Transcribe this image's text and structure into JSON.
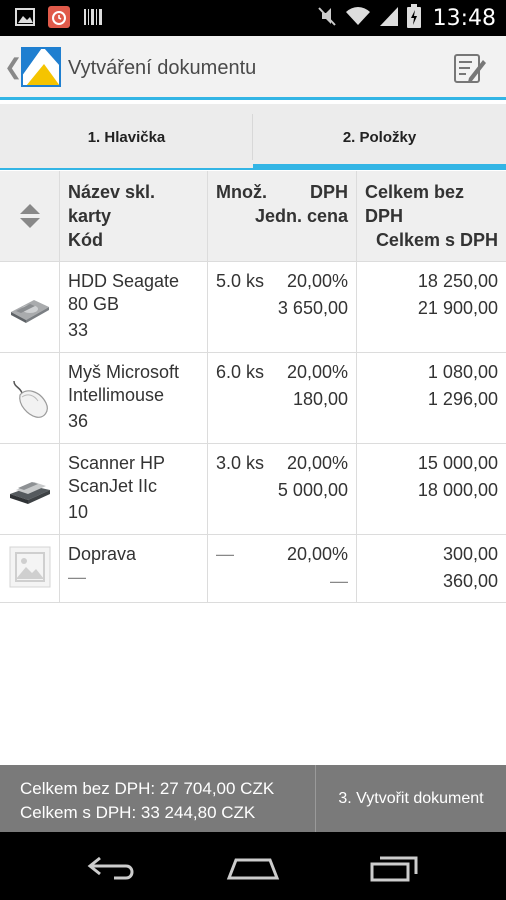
{
  "status_bar": {
    "time": "13:48",
    "left_icons": [
      "gallery-icon",
      "alarm-icon",
      "barcode-icon"
    ],
    "right_icons": [
      "mute-icon",
      "wifi-icon",
      "signal-icon",
      "battery-icon"
    ]
  },
  "action_bar": {
    "title": "Vytváření dokumentu",
    "back_glyph": "❮"
  },
  "tabs": [
    {
      "label": "1. Hlavička",
      "active": false
    },
    {
      "label": "2. Položky",
      "active": true
    }
  ],
  "table": {
    "header": {
      "name_line1": "Název skl.",
      "name_line2": "karty",
      "code": "Kód",
      "qty": "Množ.",
      "vat": "DPH",
      "unit_price": "Jedn. cena",
      "total_ex_line1": "Celkem bez",
      "total_ex_line2": "DPH",
      "total_inc": "Celkem s DPH"
    },
    "rows": [
      {
        "name_l1": "HDD Seagate",
        "name_l2": "80 GB",
        "code": "33",
        "qty": "5.0 ks",
        "vat": "20,00%",
        "unit_price": "3 650,00",
        "total_ex": "18 250,00",
        "total_inc": "21 900,00",
        "image": "hdd"
      },
      {
        "name_l1": "Myš Microsoft",
        "name_l2": "Intellimouse",
        "code": "36",
        "qty": "6.0 ks",
        "vat": "20,00%",
        "unit_price": "180,00",
        "total_ex": "1 080,00",
        "total_inc": "1 296,00",
        "image": "mouse"
      },
      {
        "name_l1": "Scanner HP",
        "name_l2": "ScanJet IIc",
        "code": "10",
        "qty": "3.0 ks",
        "vat": "20,00%",
        "unit_price": "5 000,00",
        "total_ex": "15 000,00",
        "total_inc": "18 000,00",
        "image": "scanner"
      },
      {
        "name_l1": "Doprava",
        "name_l2": "",
        "code": "—",
        "qty": "—",
        "vat": "20,00%",
        "unit_price": "—",
        "total_ex": "300,00",
        "total_inc": "360,00",
        "image": "placeholder"
      }
    ]
  },
  "footer": {
    "total_ex_vat": "Celkem bez DPH: 27 704,00 CZK",
    "total_inc_vat": "Celkem s DPH: 33 244,80 CZK",
    "create_button": "3. Vytvořit dokument"
  },
  "colors": {
    "accent": "#33b5e5",
    "footer_bg": "#7a7a7a"
  }
}
